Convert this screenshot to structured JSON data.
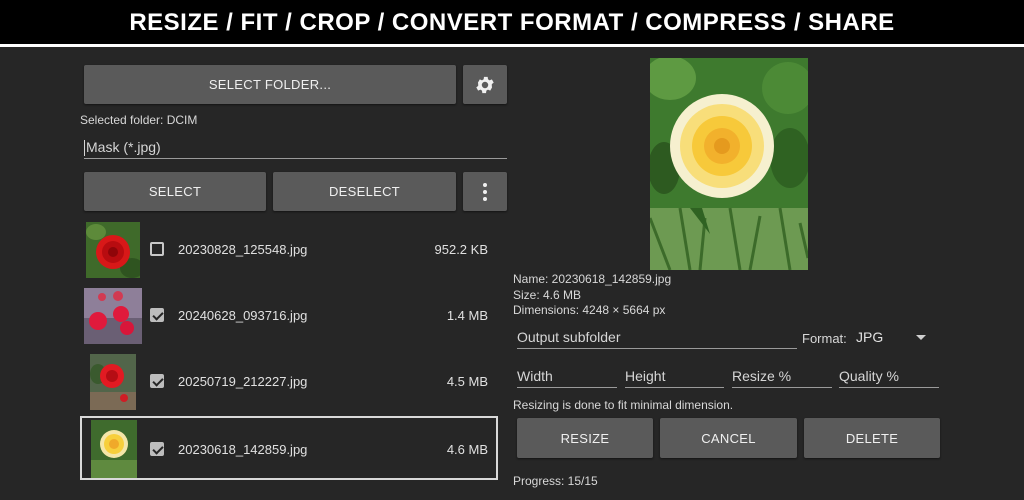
{
  "banner": {
    "text": "RESIZE / FIT / CROP / CONVERT FORMAT / COMPRESS / SHARE"
  },
  "toolbar": {
    "select_folder_label": "SELECT FOLDER...",
    "settings_icon": "gear-icon",
    "selected_folder_text": "Selected folder: DCIM",
    "mask_placeholder": "Mask (*.jpg)",
    "select_label": "SELECT",
    "deselect_label": "DESELECT",
    "more_icon": "more-vert-icon"
  },
  "files": [
    {
      "name": "20230828_125548.jpg",
      "size": "952.2 KB",
      "checked": false,
      "selected": false,
      "thumb": "red-rose"
    },
    {
      "name": "20240628_093716.jpg",
      "size": "1.4 MB",
      "checked": true,
      "selected": false,
      "thumb": "pink-roses"
    },
    {
      "name": "20250719_212227.jpg",
      "size": "4.5 MB",
      "checked": true,
      "selected": false,
      "thumb": "red-rose-garden"
    },
    {
      "name": "20230618_142859.jpg",
      "size": "4.6 MB",
      "checked": true,
      "selected": true,
      "thumb": "yellow-rose"
    }
  ],
  "preview": {
    "name_text": "Name: 20230618_142859.jpg",
    "size_text": "Size: 4.6 MB",
    "dimensions_text": "Dimensions: 4248 × 5664 px"
  },
  "output": {
    "subfolder_placeholder": "Output subfolder",
    "format_label": "Format:",
    "format_value": "JPG",
    "width_placeholder": "Width",
    "height_placeholder": "Height",
    "resize_placeholder": "Resize %",
    "quality_placeholder": "Quality %",
    "note": "Resizing is done to fit minimal dimension."
  },
  "actions": {
    "resize_label": "RESIZE",
    "cancel_label": "CANCEL",
    "delete_label": "DELETE"
  },
  "progress": {
    "text": "Progress: 15/15"
  },
  "colors": {
    "background": "#262626",
    "button": "#5a5a5a",
    "banner": "#000000"
  }
}
